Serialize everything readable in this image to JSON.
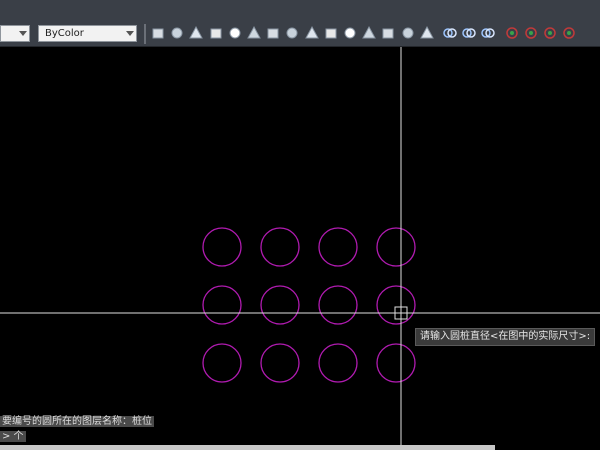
{
  "toolbar": {
    "layer_combo_value": "",
    "color_combo_value": "ByColor",
    "buttons": [
      {
        "name": "extrude-face-icon"
      },
      {
        "name": "box-icon"
      },
      {
        "name": "wedge-icon"
      },
      {
        "name": "cone-icon"
      },
      {
        "name": "sphere-icon"
      },
      {
        "name": "cylinder-icon"
      },
      {
        "name": "torus-icon"
      },
      {
        "name": "pyramid-icon"
      },
      {
        "name": "helix-icon"
      },
      {
        "name": "planar-surface-icon"
      },
      {
        "name": "extrude-icon"
      },
      {
        "name": "presspull-icon"
      },
      {
        "name": "sweep-icon"
      },
      {
        "name": "revolve-icon"
      },
      {
        "name": "loft-icon"
      },
      {
        "name": "union-icon"
      },
      {
        "name": "subtract-icon"
      },
      {
        "name": "intersect-icon"
      },
      {
        "name": "3d-move-icon"
      },
      {
        "name": "3d-rotate-icon"
      },
      {
        "name": "3d-align-icon"
      },
      {
        "name": "3d-array-icon"
      }
    ]
  },
  "drawing": {
    "circles_rows": 3,
    "circles_cols": 4,
    "circle_color": "#b01bb0",
    "crosshair_color": "#e0e0e0"
  },
  "tooltip": {
    "text": "请输入圆桩直径<在图中的实际尺寸>:"
  },
  "command": {
    "line1": "要编号的圆所在的图层名称：桩位",
    "line2": "> 个",
    "line3": ""
  }
}
